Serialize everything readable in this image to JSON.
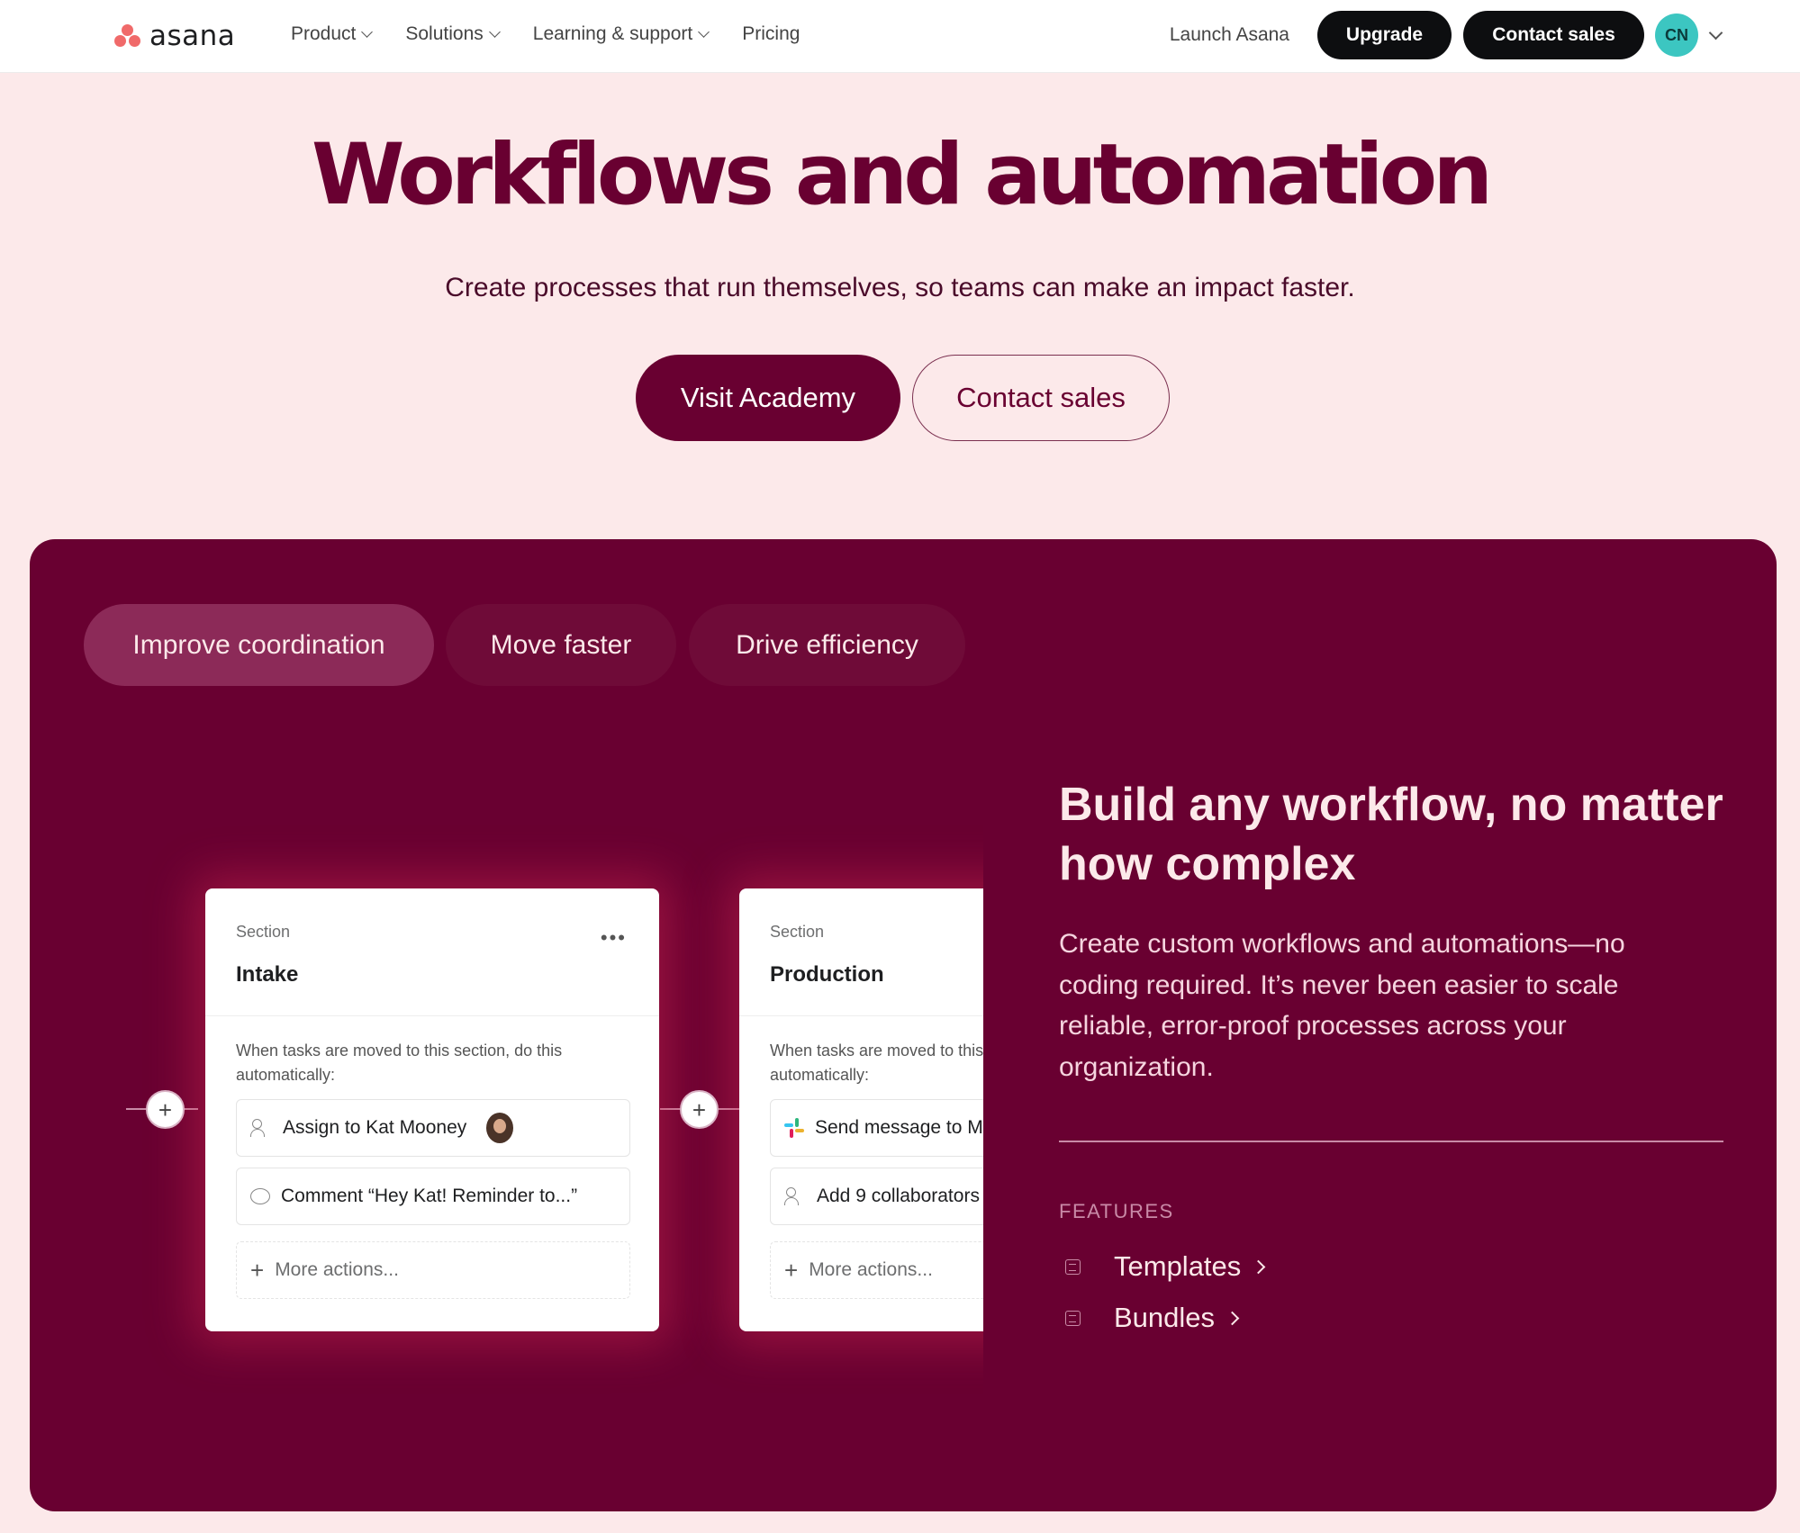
{
  "nav": {
    "logo_text": "asana",
    "menu": [
      {
        "label": "Product",
        "has_dropdown": true
      },
      {
        "label": "Solutions",
        "has_dropdown": true
      },
      {
        "label": "Learning & support",
        "has_dropdown": true
      },
      {
        "label": "Pricing",
        "has_dropdown": false
      }
    ],
    "launch_label": "Launch Asana",
    "upgrade_label": "Upgrade",
    "contact_label": "Contact sales",
    "avatar_initials": "CN"
  },
  "hero": {
    "title": "Workflows and automation",
    "subtitle": "Create processes that run themselves, so teams can make an impact faster.",
    "primary_button": "Visit Academy",
    "secondary_button": "Contact sales"
  },
  "tabs": [
    {
      "label": "Improve coordination",
      "active": true
    },
    {
      "label": "Move faster",
      "active": false
    },
    {
      "label": "Drive efficiency",
      "active": false
    }
  ],
  "cards": [
    {
      "section_label": "Section",
      "name": "Intake",
      "description": "When tasks are moved to this section, do this automatically:",
      "actions": [
        {
          "text": "Assign to Kat Mooney",
          "icon": "users-icon"
        },
        {
          "text": "Comment “Hey Kat! Reminder to...”",
          "icon": "comment-icon"
        },
        {
          "text": "More actions...",
          "icon": "plus-icon"
        }
      ]
    },
    {
      "section_label": "Section",
      "name": "Production",
      "description": "When tasks are moved to this section, do this automatically:",
      "actions": [
        {
          "text": "Send message to M",
          "icon": "slack-icon"
        },
        {
          "text": "Add 9 collaborators",
          "icon": "users-icon"
        },
        {
          "text": "More actions...",
          "icon": "plus-icon"
        }
      ]
    }
  ],
  "feature_panel": {
    "title": "Build any workflow, no matter how complex",
    "description": "Create custom workflows and automations—no coding required. It’s never been easier to scale reliable, error-proof processes across your organization.",
    "features_heading": "FEATURES",
    "links": [
      {
        "label": "Templates",
        "icon": "template-icon"
      },
      {
        "label": "Bundles",
        "icon": "bundle-icon"
      }
    ]
  },
  "colors": {
    "brand": "#690031",
    "background": "#fce9ea",
    "panel": "#690031",
    "active_tab": "#8c2a58",
    "logo_coral": "#f06a6a",
    "avatar": "#3cc6c1"
  }
}
